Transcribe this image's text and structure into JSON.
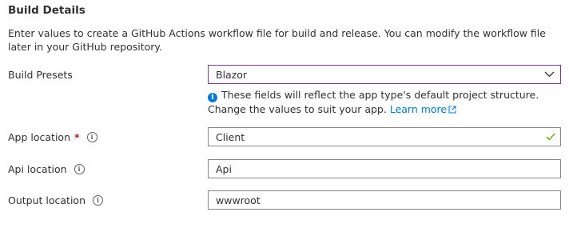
{
  "section": {
    "title": "Build Details",
    "description": "Enter values to create a GitHub Actions workflow file for build and release. You can modify the workflow file later in your GitHub repository."
  },
  "build_presets": {
    "label": "Build Presets",
    "value": "Blazor",
    "note": "These fields will reflect the app type's default project structure. Change the values to suit your app.",
    "learn_more": "Learn more"
  },
  "app_location": {
    "label": "App location",
    "required_marker": "*",
    "value": "Client"
  },
  "api_location": {
    "label": "Api location",
    "value": "Api"
  },
  "output_location": {
    "label": "Output location",
    "value": "wwwroot"
  },
  "colors": {
    "accent": "#0078d4",
    "dropdown_border": "#7a3b8c",
    "valid_check": "#57a300",
    "required": "#a4262c"
  }
}
